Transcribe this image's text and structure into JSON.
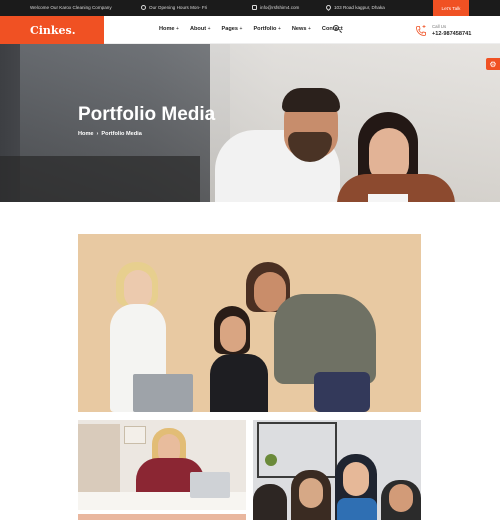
{
  "topbar": {
    "welcome": "Welcome Our Karox Cleaning Company",
    "hours": "Our Opening Hours Mon- Fri",
    "email": "info@rsfshim4.com",
    "address": "103 Road kagpur, Dhaka",
    "cta": "Let's Talk"
  },
  "header": {
    "logo": "Cinkes.",
    "nav": [
      {
        "label": "Home",
        "plus": "+"
      },
      {
        "label": "About",
        "plus": "+"
      },
      {
        "label": "Pages",
        "plus": "+"
      },
      {
        "label": "Portfolio",
        "plus": "+"
      },
      {
        "label": "News",
        "plus": "+"
      },
      {
        "label": "Contact",
        "plus": ""
      }
    ],
    "call_label": "Call Us",
    "phone": "+12-987458741"
  },
  "hero": {
    "title": "Portfolio Media",
    "breadcrumb_home": "Home",
    "breadcrumb_sep": "›",
    "breadcrumb_current": "Portfolio Media"
  },
  "colors": {
    "accent": "#f05123",
    "topbar_bg": "#1b1b1b"
  },
  "icons": [
    "clock-icon",
    "mail-icon",
    "pin-icon",
    "phone-icon",
    "search-icon",
    "gear-icon"
  ]
}
